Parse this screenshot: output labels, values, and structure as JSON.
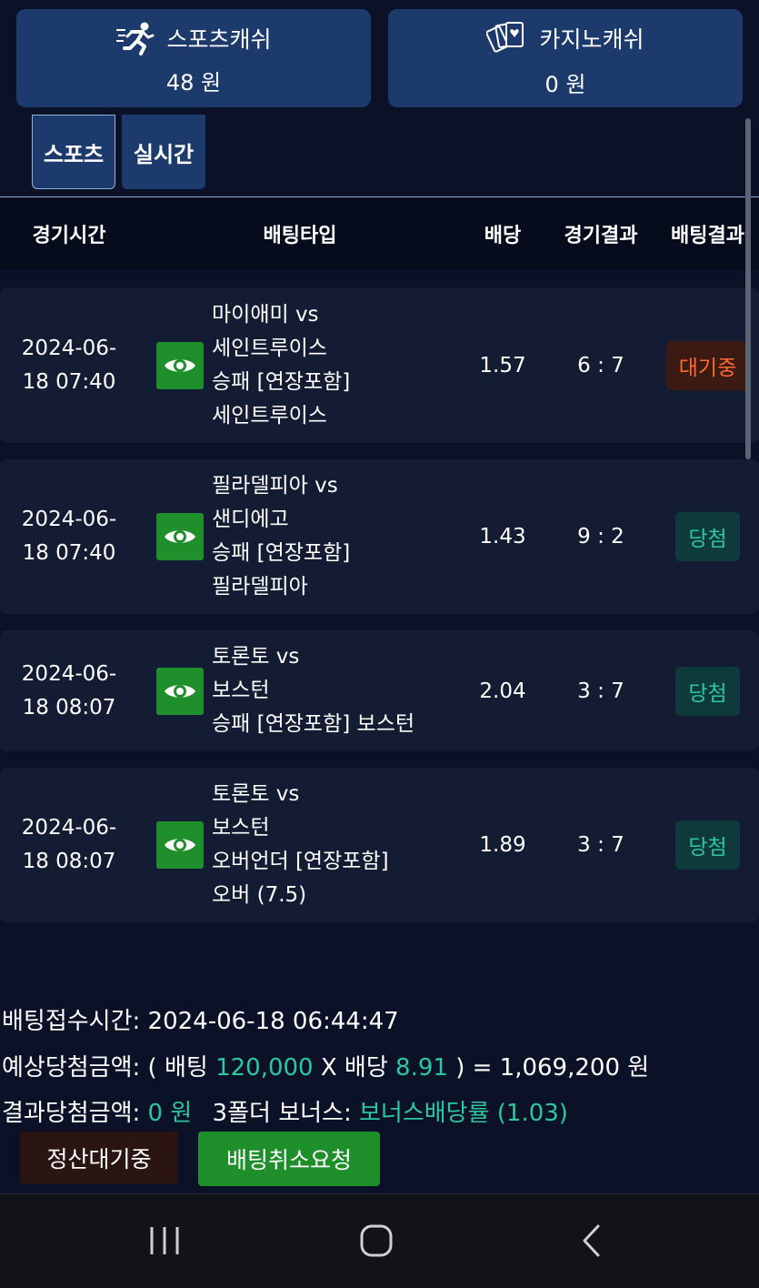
{
  "wallets": {
    "sports": {
      "icon": "runner-icon",
      "label": "스포츠캐쉬",
      "amount": "48 원"
    },
    "casino": {
      "icon": "playing-cards-icon",
      "label": "카지노캐쉬",
      "amount": "0 원"
    }
  },
  "tabs": [
    {
      "label": "스포츠",
      "active": true
    },
    {
      "label": "실시간",
      "active": false
    }
  ],
  "table": {
    "headers": {
      "time": "경기시간",
      "type": "배팅타입",
      "odds": "배당",
      "result": "경기결과",
      "bet_result": "배팅결과"
    },
    "rows": [
      {
        "time1": "2024-06-",
        "time2": "18 07:40",
        "lines": [
          "마이애미 vs",
          "세인트루이스",
          "승패 [연장포함]",
          "세인트루이스"
        ],
        "odds": "1.57",
        "score": "6 : 7",
        "status": "대기중",
        "status_type": "wait"
      },
      {
        "time1": "2024-06-",
        "time2": "18 07:40",
        "lines": [
          "필라델피아 vs",
          "샌디에고",
          "승패 [연장포함]",
          "필라델피아"
        ],
        "odds": "1.43",
        "score": "9 : 2",
        "status": "당첨",
        "status_type": "win"
      },
      {
        "time1": "2024-06-",
        "time2": "18 08:07",
        "lines": [
          "토론토 vs",
          "보스턴",
          "승패 [연장포함] 보스턴"
        ],
        "odds": "2.04",
        "score": "3 : 7",
        "status": "당첨",
        "status_type": "win"
      },
      {
        "time1": "2024-06-",
        "time2": "18 08:07",
        "lines": [
          "토론토 vs",
          "보스턴",
          "오버언더 [연장포함]",
          "오버 (7.5)"
        ],
        "odds": "1.89",
        "score": "3 : 7",
        "status": "당첨",
        "status_type": "win"
      }
    ]
  },
  "summary": {
    "accept_time_label": "배팅접수시간:",
    "accept_time": "2024-06-18 06:44:47",
    "expected_label": "예상당첨금액: ( 배팅",
    "bet_amount": "120,000",
    "x_label": "X 배당",
    "total_odds": "8.91",
    "expected_tail": ") = 1,069,200 원",
    "result_label": "결과당첨금액:",
    "result_amount": "0 원",
    "bonus_label": "3폴더 보너스:",
    "bonus_value": "보너스배당률 (1.03)"
  },
  "actions": {
    "pending": "정산대기중",
    "cancel": "배팅취소요청"
  },
  "colors": {
    "card": "#1c3a6b",
    "green_btn": "#1e8f2a",
    "accent_green": "#2cc7a0",
    "wait_orange": "#ff6a2a"
  }
}
